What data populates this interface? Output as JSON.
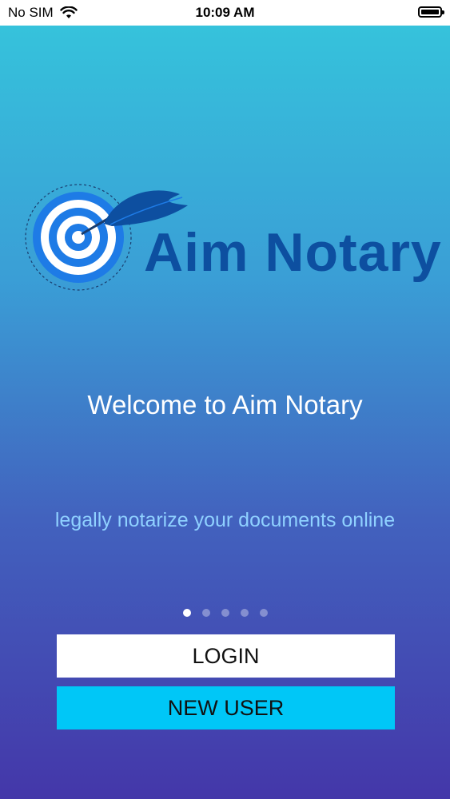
{
  "status_bar": {
    "carrier": "No SIM",
    "time": "10:09 AM",
    "wifi_icon": "wifi-icon",
    "battery_icon": "battery-icon"
  },
  "logo": {
    "text": "Aim Notary",
    "icon": "target-feather-icon",
    "colors": {
      "text": "#0d4fa0",
      "target_blue": "#1e7be6"
    }
  },
  "welcome": {
    "title": "Welcome to Aim Notary"
  },
  "tagline": {
    "text": "legally notarize your documents online"
  },
  "pager": {
    "count": 5,
    "active_index": 0
  },
  "buttons": {
    "login": "LOGIN",
    "new_user": "NEW USER"
  },
  "colors": {
    "gradient_top": "#35c6dc",
    "gradient_bottom": "#4437a9",
    "new_user_button": "#00c7f7",
    "tagline": "#8fd1ff"
  }
}
